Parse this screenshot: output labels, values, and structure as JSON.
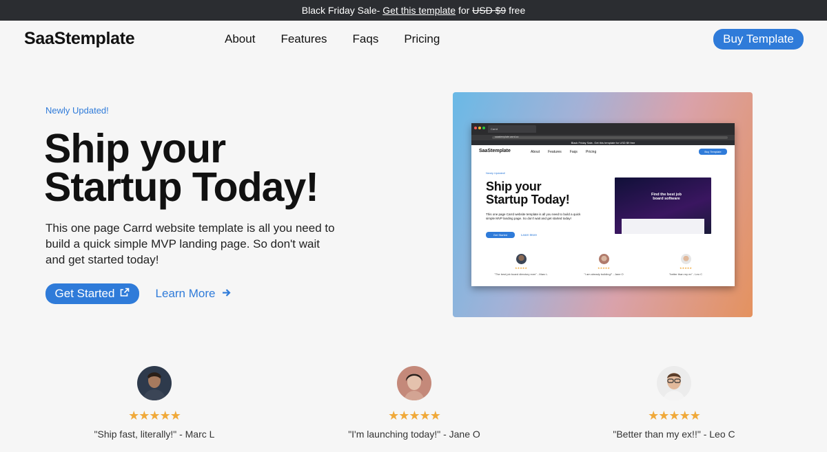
{
  "banner": {
    "prefix": "Black Friday Sale- ",
    "link": "Get this template",
    "mid": " for ",
    "old_price": "USD $9",
    "suffix": " free"
  },
  "nav": {
    "logo": "SaaStemplate",
    "links": [
      "About",
      "Features",
      "Faqs",
      "Pricing"
    ],
    "buy_label": "Buy Template"
  },
  "hero": {
    "eyebrow": "Newly Updated!",
    "headline_line1": "Ship your",
    "headline_line2": "Startup Today!",
    "lead": "This one page Carrd website template is all you need to build a quick simple MVP landing page. So don't wait and get started today!",
    "cta_label": "Get Started",
    "learn_label": "Learn More"
  },
  "mockup": {
    "tab_label": "Carrd",
    "url": "saastemplate.carrd.co",
    "banner": "Black Friday Sale- Get this template for USD $9 free",
    "logo": "SaaStemplate",
    "links": [
      "About",
      "Features",
      "Faqs",
      "Pricing"
    ],
    "buy_label": "Buy Template",
    "eyebrow": "Newly Updated!",
    "headline_line1": "Ship your",
    "headline_line2": "Startup Today!",
    "lead": "This one page Carrd website template is all you need to build a quick simple MVP landing page. So don't wait and get started today!",
    "cta_label": "Get Started",
    "learn_label": "Learn More",
    "shot_text": "Find the best job board software",
    "testimonials": [
      {
        "quote": "\"The best job board directory ever\" - Marc L"
      },
      {
        "quote": "\"I am already building!\" - Jane O"
      },
      {
        "quote": "\"better than my ex\" - Leo C"
      }
    ]
  },
  "testimonials": [
    {
      "quote": "\"Ship fast, literally!\" - Marc L",
      "stars": "★★★★★"
    },
    {
      "quote": "\"I'm launching today!\" - Jane O",
      "stars": "★★★★★"
    },
    {
      "quote": "\"Better than my ex!!\" - Leo C",
      "stars": "★★★★★"
    }
  ],
  "colors": {
    "accent": "#2f7bd9",
    "banner_bg": "#2b2d31",
    "star": "#f0a93a",
    "page_bg": "#f6f6f6"
  }
}
